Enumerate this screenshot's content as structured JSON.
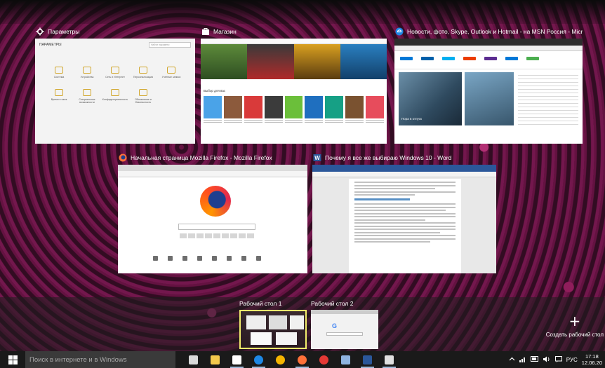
{
  "windows": [
    {
      "title": "Параметры",
      "icon": "gear-icon",
      "app_title": "ПАРАМЕТРЫ",
      "search_placeholder": "Найти параметр"
    },
    {
      "title": "Магазин",
      "icon": "store-icon"
    },
    {
      "title": "Новости, фото, Skype, Outlook и Hotmail - на MSN Россия - Micr...",
      "icon": "edge-icon"
    },
    {
      "title": "Начальная страница Mozilla Firefox - Mozilla Firefox",
      "icon": "firefox-icon"
    },
    {
      "title": "Почему я все же выбираю Windows 10 - Word",
      "icon": "word-icon"
    }
  ],
  "settings_items": [
    {
      "label": "Система",
      "icon": "system-icon"
    },
    {
      "label": "Устройства",
      "icon": "devices-icon"
    },
    {
      "label": "Сеть и Интернет",
      "icon": "network-icon"
    },
    {
      "label": "Персонализация",
      "icon": "personalization-icon"
    },
    {
      "label": "Учетные записи",
      "icon": "accounts-icon"
    },
    {
      "label": "Время и язык",
      "icon": "time-language-icon"
    },
    {
      "label": "Специальные возможности",
      "icon": "accessibility-icon"
    },
    {
      "label": "Конфиденциальность",
      "icon": "privacy-icon"
    },
    {
      "label": "Обновление и безопасность",
      "icon": "update-icon"
    }
  ],
  "store": {
    "section": "Выбор для вас",
    "hero_text": "MINECRAFT"
  },
  "msn": {
    "hero_caption": "Пора в отпуск"
  },
  "desktops": [
    {
      "label": "Рабочий стол 1",
      "active": true
    },
    {
      "label": "Рабочий стол 2",
      "active": false
    }
  ],
  "add_desktop_label": "Создать рабочий стол",
  "taskbar": {
    "search_placeholder": "Поиск в интернете и в Windows",
    "apps": [
      {
        "name": "task-view-icon",
        "color": "#d9d9d9",
        "open": false
      },
      {
        "name": "file-explorer-icon",
        "color": "#f2c94c",
        "open": false
      },
      {
        "name": "store-icon",
        "color": "#ffffff",
        "open": true
      },
      {
        "name": "edge-icon",
        "color": "#1e88e5",
        "open": true
      },
      {
        "name": "chrome-icon",
        "color": "#f4b400",
        "open": false
      },
      {
        "name": "firefox-icon",
        "color": "#ff7139",
        "open": true
      },
      {
        "name": "yandex-icon",
        "color": "#e53935",
        "open": false
      },
      {
        "name": "photos-icon",
        "color": "#8fb4e0",
        "open": false
      },
      {
        "name": "word-icon",
        "color": "#2b579a",
        "open": true
      },
      {
        "name": "settings-icon",
        "color": "#e0e0e0",
        "open": true
      }
    ],
    "language": "РУС",
    "time": "17:18",
    "date": "12.06.20"
  }
}
